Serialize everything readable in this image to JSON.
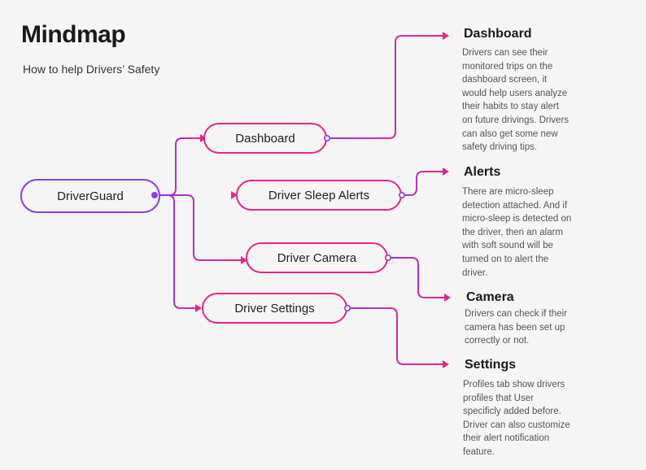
{
  "header": {
    "title": "Mindmap",
    "subtitle": "How to help Drivers’ Safety"
  },
  "colors": {
    "pink": "#e8248a",
    "purple": "#8e3be0",
    "background": "#f5f5f5"
  },
  "mindmap": {
    "root": {
      "label": "DriverGuard"
    },
    "branches": [
      {
        "label": "Dashboard"
      },
      {
        "label": "Driver Sleep Alerts"
      },
      {
        "label": "Driver Camera"
      },
      {
        "label": "Driver Settings"
      }
    ],
    "leaves": [
      {
        "heading": "Dashboard",
        "lines": [
          "Drivers can see their",
          "monitored trips on the",
          "dashboard screen, it",
          "would help users analyze",
          "their habits to stay alert",
          "on future drivings. Drivers",
          "can also get some new",
          "safety driving tips."
        ]
      },
      {
        "heading": "Alerts",
        "lines": [
          "There are micro-sleep",
          "detection attached. And if",
          "micro-sleep is detected on",
          "the driver, then an alarm",
          "with soft sound will be",
          "turned on to alert the",
          "driver."
        ]
      },
      {
        "heading": "Camera",
        "lines": [
          "Drivers can check if their",
          "camera has been set up",
          "correctly or not."
        ]
      },
      {
        "heading": "Settings",
        "lines": [
          "Profiles tab show drivers",
          "profiles that User",
          "specificly added before.",
          "Driver can also customize",
          "their alert notification",
          "feature."
        ]
      }
    ]
  }
}
